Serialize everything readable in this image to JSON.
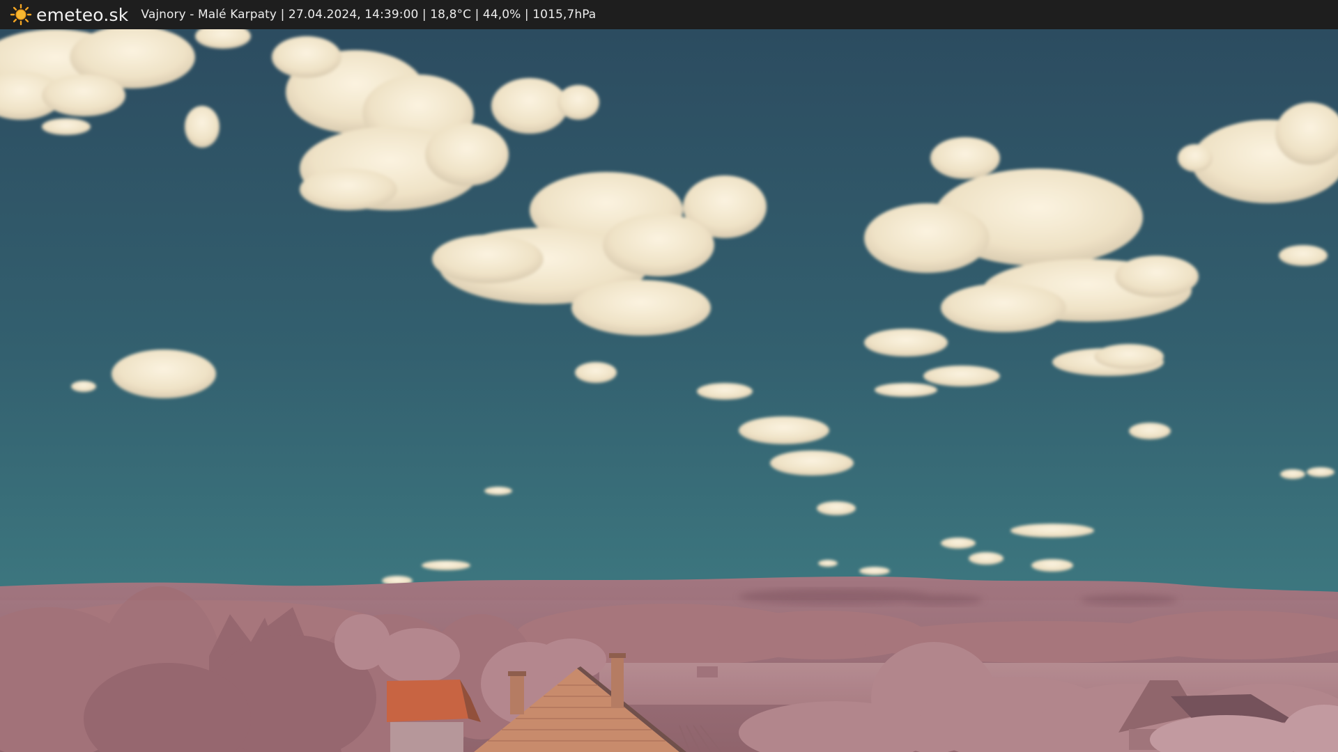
{
  "header": {
    "brand": "emeteo.sk",
    "logo_icon": "sun-icon",
    "info_text": "Vajnory - Malé Karpaty | 27.04.2024, 14:39:00 | 18,8°C | 44,0% | 1015,7hPa"
  },
  "colors": {
    "bar_background": "#1e1e1e",
    "sun": "#f5a623",
    "sky_top": "#2e4f62",
    "sky_horizon": "#3f7a80",
    "cloud": "#f4ead4",
    "foliage": "#b17f84",
    "hills": "#9c6e75",
    "roof": "#c9603a"
  }
}
